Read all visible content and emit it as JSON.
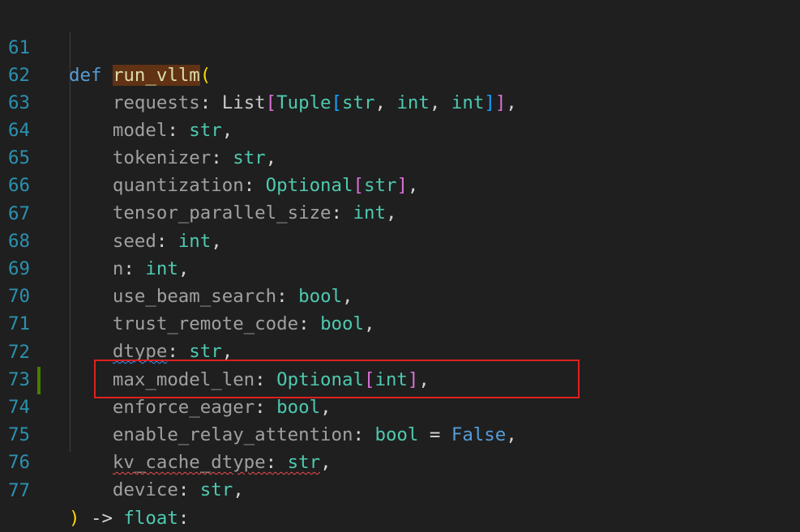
{
  "editor": {
    "lines": [
      {
        "num": "61"
      },
      {
        "num": "62"
      },
      {
        "num": "63"
      },
      {
        "num": "64"
      },
      {
        "num": "65"
      },
      {
        "num": "66"
      },
      {
        "num": "67"
      },
      {
        "num": "68"
      },
      {
        "num": "69"
      },
      {
        "num": "70"
      },
      {
        "num": "71"
      },
      {
        "num": "72"
      },
      {
        "num": "73"
      },
      {
        "num": "74"
      },
      {
        "num": "75"
      },
      {
        "num": "76"
      },
      {
        "num": "77"
      }
    ],
    "tokens": {
      "def": "def",
      "func_name": "run_vllm",
      "open_paren": "(",
      "close_paren": ")",
      "arrow": " -> ",
      "float": "float",
      "colon": ":",
      "requests": "requests",
      "List": "List",
      "Tuple": "Tuple",
      "str": "str",
      "int": "int",
      "bool": "bool",
      "Optional": "Optional",
      "model": "model",
      "tokenizer": "tokenizer",
      "quantization": "quantization",
      "tensor_parallel_size": "tensor_parallel_size",
      "seed": "seed",
      "n": "n",
      "use_beam_search": "use_beam_search",
      "trust_remote_code": "trust_remote_code",
      "dtype": "dtype",
      "max_model_len": "max_model_len",
      "enforce_eager": "enforce_eager",
      "enable_relay_attention": "enable_relay_attention",
      "equals": " = ",
      "False": "False",
      "kv_cache_dtype": "kv_cache_dtype",
      "device": "device"
    }
  },
  "colors": {
    "background": "#1f1f1f",
    "line_number": "#2b91af",
    "keyword": "#569cd6",
    "type": "#4ec9b0",
    "highlight_box": "#e02020"
  }
}
